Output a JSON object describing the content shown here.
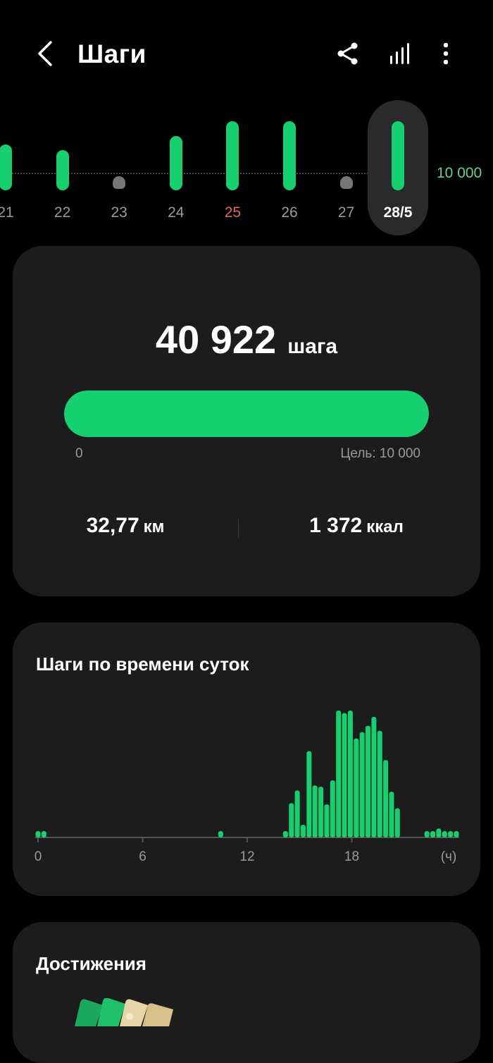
{
  "header": {
    "title": "Шаги"
  },
  "day_strip": {
    "goal_label": "10 000",
    "days": [
      {
        "label": "21",
        "steps": 11000,
        "type": "bar"
      },
      {
        "label": "22",
        "steps": 9000,
        "type": "bar"
      },
      {
        "label": "23",
        "steps": 0,
        "type": "dot"
      },
      {
        "label": "24",
        "steps": 14000,
        "type": "bar"
      },
      {
        "label": "25",
        "steps": 24000,
        "type": "bar",
        "highlight": "red"
      },
      {
        "label": "26",
        "steps": 23000,
        "type": "bar"
      },
      {
        "label": "27",
        "steps": 0,
        "type": "dot"
      },
      {
        "label": "28/5",
        "steps": 40922,
        "type": "bar",
        "selected": true
      }
    ]
  },
  "summary": {
    "steps": "40 922",
    "steps_unit": "шага",
    "progress_fraction": 1.0,
    "progress_min": "0",
    "progress_goal": "Цель: 10 000",
    "distance": "32,77",
    "distance_unit": "км",
    "calories": "1 372",
    "calories_unit": "ккал"
  },
  "hourly": {
    "title": "Шаги по времени суток",
    "chart_data": {
      "type": "bar",
      "title": "Шаги по времени суток",
      "x_ticks": [
        "0",
        "6",
        "12",
        "18"
      ],
      "x_unit": "(ч)",
      "xlim": [
        0,
        24
      ],
      "ylim": [
        0,
        1
      ],
      "bar_color": "#14d06e",
      "values": [
        0.05,
        0.05,
        0,
        0,
        0,
        0,
        0,
        0,
        0,
        0,
        0,
        0,
        0,
        0,
        0,
        0,
        0,
        0,
        0,
        0,
        0,
        0,
        0,
        0,
        0,
        0,
        0,
        0,
        0,
        0,
        0,
        0.05,
        0,
        0,
        0,
        0,
        0,
        0,
        0,
        0,
        0,
        0,
        0.05,
        0.27,
        0.37,
        0.1,
        0.68,
        0.41,
        0.4,
        0.26,
        0.45,
        1.0,
        0.98,
        1.0,
        0.78,
        0.83,
        0.88,
        0.95,
        0.84,
        0.61,
        0.36,
        0.23,
        0,
        0,
        0,
        0,
        0.05,
        0.05,
        0.07,
        0.05,
        0.05,
        0.05
      ]
    }
  },
  "achievements": {
    "title": "Достижения"
  },
  "colors": {
    "accent": "#14d06e",
    "card": "#1c1c1c",
    "background": "#000000",
    "muted": "#9a9a9a",
    "weekend": "#e0645a"
  },
  "icons": {
    "back": "chevron-left-icon",
    "share": "share-icon",
    "stats": "bar-chart-icon",
    "more": "more-vertical-icon"
  }
}
